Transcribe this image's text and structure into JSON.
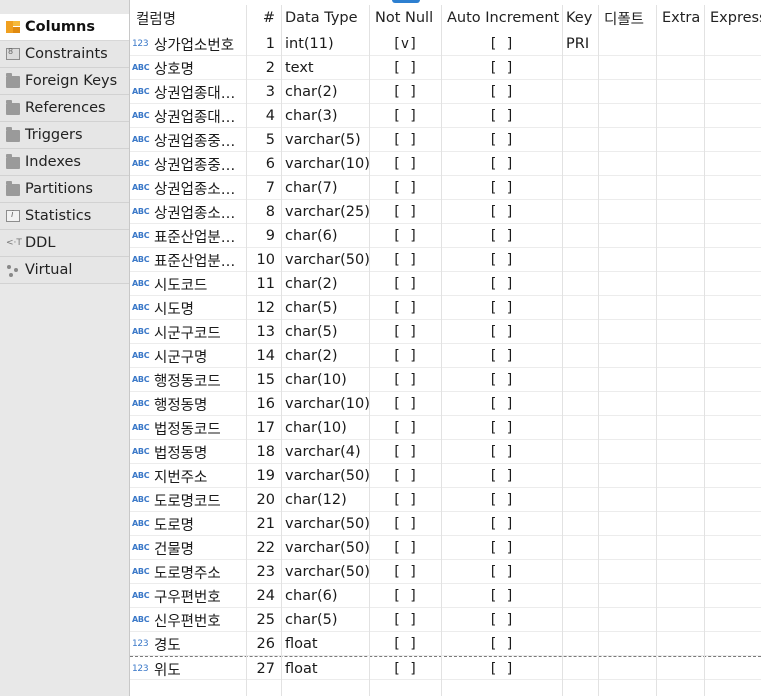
{
  "sidebar": {
    "tabs": [
      {
        "label": "Columns",
        "icon": "columns-icon",
        "active": true
      },
      {
        "label": "Constraints",
        "icon": "constraints-icon"
      },
      {
        "label": "Foreign Keys",
        "icon": "folder-icon"
      },
      {
        "label": "References",
        "icon": "folder-icon"
      },
      {
        "label": "Triggers",
        "icon": "folder-icon"
      },
      {
        "label": "Indexes",
        "icon": "folder-icon"
      },
      {
        "label": "Partitions",
        "icon": "folder-icon"
      },
      {
        "label": "Statistics",
        "icon": "statistics-icon"
      },
      {
        "label": "DDL",
        "icon": "ddl-icon"
      },
      {
        "label": "Virtual",
        "icon": "virtual-icon"
      }
    ]
  },
  "grid": {
    "headers": {
      "name": "컬럼명",
      "num": "#",
      "type": "Data Type",
      "not_null": "Not Null",
      "auto_increment": "Auto Increment",
      "key": "Key",
      "default": "디폴트",
      "extra": "Extra",
      "expression": "Expressi"
    },
    "type_icons": {
      "number": "123",
      "string": "ABC"
    },
    "accent_color": "#3a78c8",
    "rows": [
      {
        "name": "상가업소번호",
        "kind": "number",
        "num": "1",
        "type": "int(11)",
        "not_null": "[v]",
        "auto_increment": "[ ]",
        "key": "PRI"
      },
      {
        "name": "상호명",
        "kind": "string",
        "num": "2",
        "type": "text",
        "not_null": "[ ]",
        "auto_increment": "[ ]",
        "key": ""
      },
      {
        "name": "상권업종대…",
        "kind": "string",
        "num": "3",
        "type": "char(2)",
        "not_null": "[ ]",
        "auto_increment": "[ ]",
        "key": ""
      },
      {
        "name": "상권업종대…",
        "kind": "string",
        "num": "4",
        "type": "char(3)",
        "not_null": "[ ]",
        "auto_increment": "[ ]",
        "key": ""
      },
      {
        "name": "상권업종중…",
        "kind": "string",
        "num": "5",
        "type": "varchar(5)",
        "not_null": "[ ]",
        "auto_increment": "[ ]",
        "key": ""
      },
      {
        "name": "상권업종중…",
        "kind": "string",
        "num": "6",
        "type": "varchar(10)",
        "not_null": "[ ]",
        "auto_increment": "[ ]",
        "key": ""
      },
      {
        "name": "상권업종소…",
        "kind": "string",
        "num": "7",
        "type": "char(7)",
        "not_null": "[ ]",
        "auto_increment": "[ ]",
        "key": ""
      },
      {
        "name": "상권업종소…",
        "kind": "string",
        "num": "8",
        "type": "varchar(25)",
        "not_null": "[ ]",
        "auto_increment": "[ ]",
        "key": ""
      },
      {
        "name": "표준산업분…",
        "kind": "string",
        "num": "9",
        "type": "char(6)",
        "not_null": "[ ]",
        "auto_increment": "[ ]",
        "key": ""
      },
      {
        "name": "표준산업분…",
        "kind": "string",
        "num": "10",
        "type": "varchar(50)",
        "not_null": "[ ]",
        "auto_increment": "[ ]",
        "key": ""
      },
      {
        "name": "시도코드",
        "kind": "string",
        "num": "11",
        "type": "char(2)",
        "not_null": "[ ]",
        "auto_increment": "[ ]",
        "key": ""
      },
      {
        "name": "시도명",
        "kind": "string",
        "num": "12",
        "type": "char(5)",
        "not_null": "[ ]",
        "auto_increment": "[ ]",
        "key": ""
      },
      {
        "name": "시군구코드",
        "kind": "string",
        "num": "13",
        "type": "char(5)",
        "not_null": "[ ]",
        "auto_increment": "[ ]",
        "key": ""
      },
      {
        "name": "시군구명",
        "kind": "string",
        "num": "14",
        "type": "char(2)",
        "not_null": "[ ]",
        "auto_increment": "[ ]",
        "key": ""
      },
      {
        "name": "행정동코드",
        "kind": "string",
        "num": "15",
        "type": "char(10)",
        "not_null": "[ ]",
        "auto_increment": "[ ]",
        "key": ""
      },
      {
        "name": "행정동명",
        "kind": "string",
        "num": "16",
        "type": "varchar(10)",
        "not_null": "[ ]",
        "auto_increment": "[ ]",
        "key": ""
      },
      {
        "name": "법정동코드",
        "kind": "string",
        "num": "17",
        "type": "char(10)",
        "not_null": "[ ]",
        "auto_increment": "[ ]",
        "key": ""
      },
      {
        "name": "법정동명",
        "kind": "string",
        "num": "18",
        "type": "varchar(4)",
        "not_null": "[ ]",
        "auto_increment": "[ ]",
        "key": ""
      },
      {
        "name": "지번주소",
        "kind": "string",
        "num": "19",
        "type": "varchar(50)",
        "not_null": "[ ]",
        "auto_increment": "[ ]",
        "key": ""
      },
      {
        "name": "도로명코드",
        "kind": "string",
        "num": "20",
        "type": "char(12)",
        "not_null": "[ ]",
        "auto_increment": "[ ]",
        "key": ""
      },
      {
        "name": "도로명",
        "kind": "string",
        "num": "21",
        "type": "varchar(50)",
        "not_null": "[ ]",
        "auto_increment": "[ ]",
        "key": ""
      },
      {
        "name": "건물명",
        "kind": "string",
        "num": "22",
        "type": "varchar(50)",
        "not_null": "[ ]",
        "auto_increment": "[ ]",
        "key": ""
      },
      {
        "name": "도로명주소",
        "kind": "string",
        "num": "23",
        "type": "varchar(50)",
        "not_null": "[ ]",
        "auto_increment": "[ ]",
        "key": ""
      },
      {
        "name": "구우편번호",
        "kind": "string",
        "num": "24",
        "type": "char(6)",
        "not_null": "[ ]",
        "auto_increment": "[ ]",
        "key": ""
      },
      {
        "name": "신우편번호",
        "kind": "string",
        "num": "25",
        "type": "char(5)",
        "not_null": "[ ]",
        "auto_increment": "[ ]",
        "key": ""
      },
      {
        "name": "경도",
        "kind": "number",
        "num": "26",
        "type": "float",
        "not_null": "[ ]",
        "auto_increment": "[ ]",
        "key": ""
      },
      {
        "name": "위도",
        "kind": "number",
        "num": "27",
        "type": "float",
        "not_null": "[ ]",
        "auto_increment": "[ ]",
        "key": ""
      }
    ]
  }
}
